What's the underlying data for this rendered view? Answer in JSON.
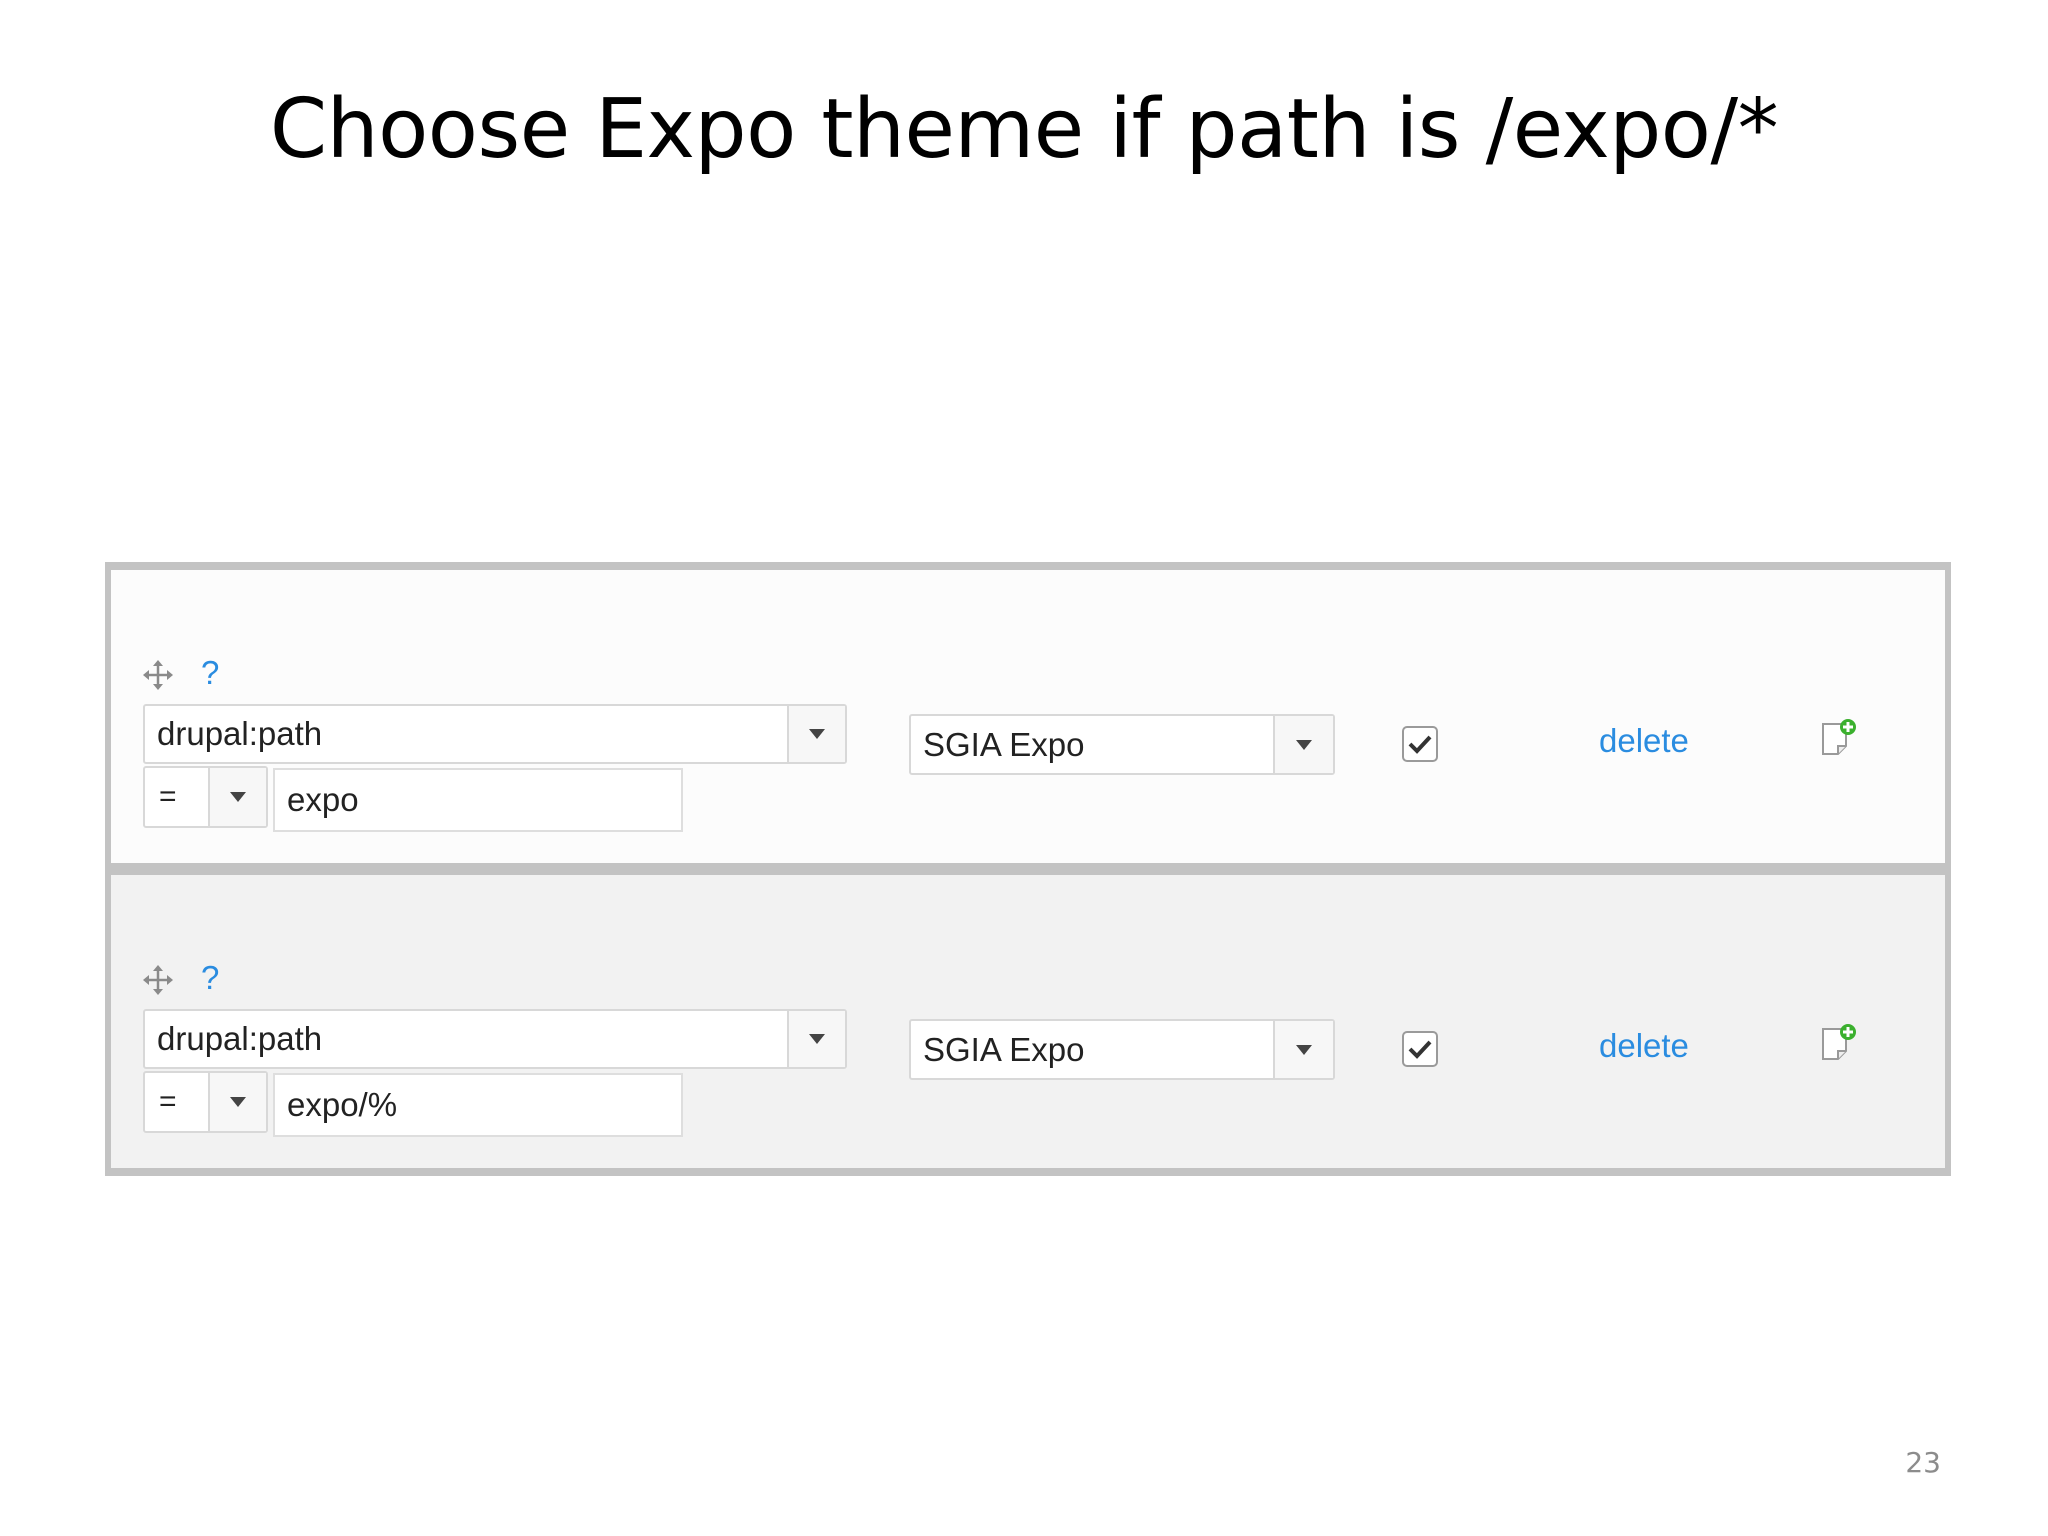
{
  "slide": {
    "title": "Choose Expo theme if path is /expo/*",
    "page_number": "23"
  },
  "rules": [
    {
      "help": "?",
      "condition": "drupal:path",
      "operator": "=",
      "value": "expo",
      "theme": "SGIA Expo",
      "enabled": true,
      "delete_label": "delete"
    },
    {
      "help": "?",
      "condition": "drupal:path",
      "operator": "=",
      "value": "expo/%",
      "theme": "SGIA Expo",
      "enabled": true,
      "delete_label": "delete"
    }
  ],
  "icons": {
    "drag": "drag-handle-icon",
    "dropdown": "chevron-down-icon",
    "check": "checkmark-icon",
    "add": "add-note-icon"
  },
  "colors": {
    "link": "#2a8ce0",
    "add_icon_plus": "#3bb02e",
    "row_odd": "#fcfcfc",
    "row_even": "#f2f2f2",
    "table_border": "#c3c3c3"
  }
}
